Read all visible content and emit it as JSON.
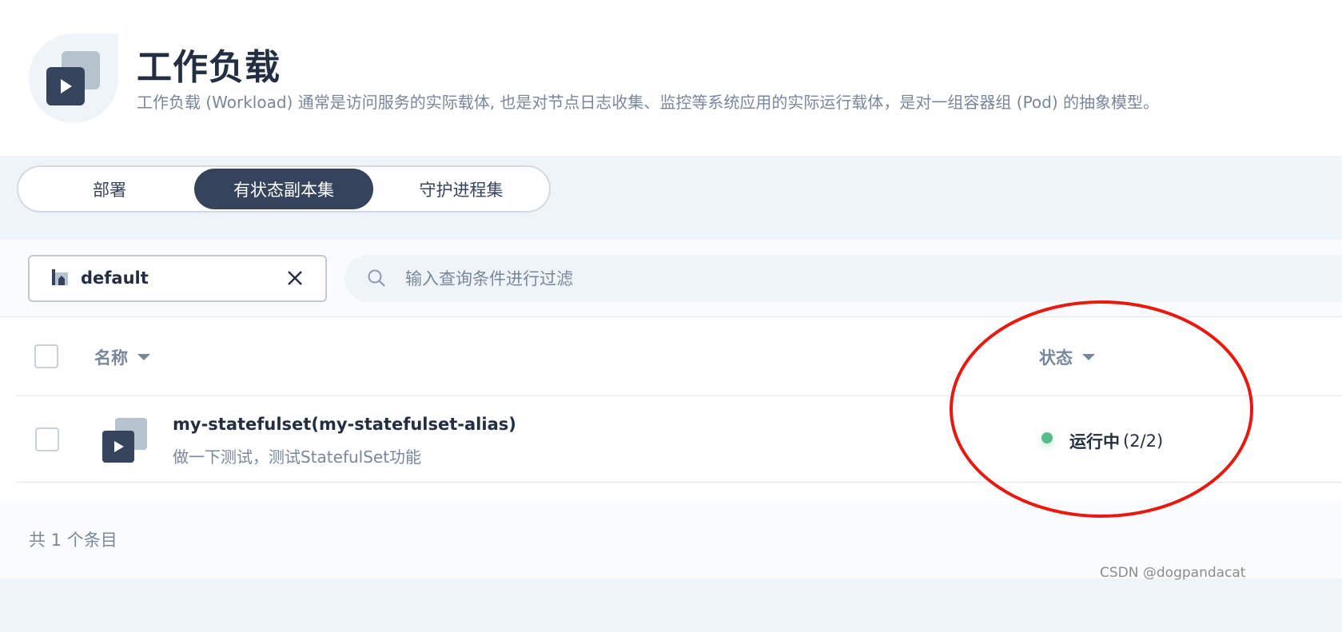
{
  "header": {
    "title": "工作负载",
    "description": "工作负载 (Workload) 通常是访问服务的实际载体, 也是对节点日志收集、监控等系统应用的实际运行载体，是对一组容器组 (Pod) 的抽象模型。",
    "icon": "workload-icon"
  },
  "tabs": [
    {
      "label": "部署",
      "active": false
    },
    {
      "label": "有状态副本集",
      "active": true
    },
    {
      "label": "守护进程集",
      "active": false
    }
  ],
  "toolbar": {
    "namespace": {
      "value": "default",
      "icon": "namespace-icon",
      "clear_icon": "close-icon"
    },
    "search": {
      "placeholder": "输入查询条件进行过滤",
      "value": "",
      "icon": "search-icon"
    }
  },
  "table": {
    "columns": [
      {
        "label": "名称",
        "sortable": true
      },
      {
        "label": "状态",
        "sortable": true
      }
    ],
    "rows": [
      {
        "name": "my-statefulset(my-statefulset-alias)",
        "description": "做一下测试，测试StatefulSet功能",
        "status_label": "运行中",
        "status_count": "(2/2)",
        "status_color": "#55bc8a"
      }
    ]
  },
  "footer": {
    "total": "共 1 个条目"
  },
  "annotation": {
    "shape": "ellipse",
    "color": "#e8190f"
  },
  "watermark": "CSDN @dogpandacat",
  "colors": {
    "primary_dark": "#36435c",
    "text": "#242e42",
    "muted": "#79879c",
    "background": "#eff4f9",
    "success": "#55bc8a"
  }
}
